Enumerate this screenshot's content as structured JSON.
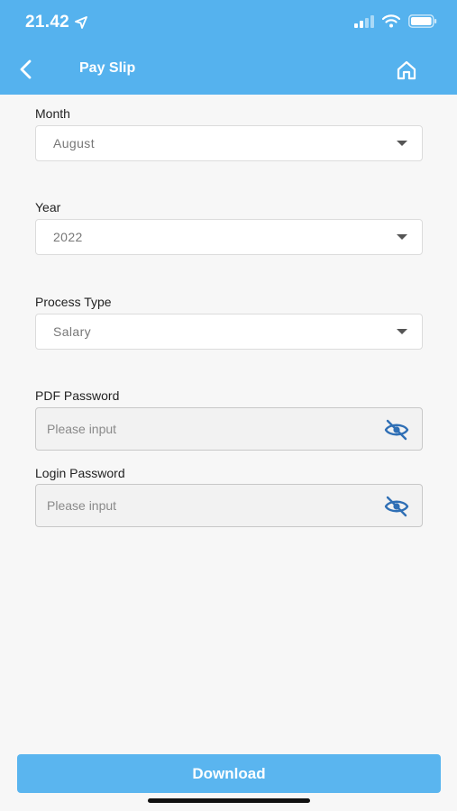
{
  "status_bar": {
    "time": "21.42"
  },
  "nav": {
    "title": "Pay Slip"
  },
  "form": {
    "month": {
      "label": "Month",
      "value": "August"
    },
    "year": {
      "label": "Year",
      "value": "2022"
    },
    "process_type": {
      "label": "Process Type",
      "value": "Salary"
    },
    "pdf_password": {
      "label": "PDF Password",
      "placeholder": "Please input"
    },
    "login_password": {
      "label": "Login Password",
      "placeholder": "Please input"
    }
  },
  "actions": {
    "download_label": "Download"
  },
  "colors": {
    "header": "#55b2ee",
    "button": "#5ab5ef",
    "eye_icon": "#2f6fb5"
  },
  "icons": [
    "location-arrow-icon",
    "cellular-signal-icon",
    "wifi-icon",
    "battery-icon",
    "back-chevron-icon",
    "home-icon",
    "eye-off-icon"
  ]
}
